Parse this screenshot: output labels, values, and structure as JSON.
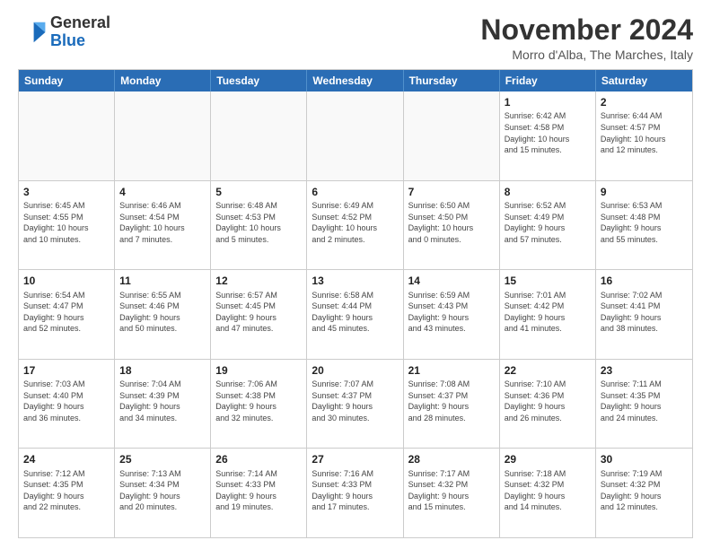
{
  "logo": {
    "text_general": "General",
    "text_blue": "Blue"
  },
  "title": "November 2024",
  "subtitle": "Morro d'Alba, The Marches, Italy",
  "header_days": [
    "Sunday",
    "Monday",
    "Tuesday",
    "Wednesday",
    "Thursday",
    "Friday",
    "Saturday"
  ],
  "weeks": [
    [
      {
        "day": "",
        "info": ""
      },
      {
        "day": "",
        "info": ""
      },
      {
        "day": "",
        "info": ""
      },
      {
        "day": "",
        "info": ""
      },
      {
        "day": "",
        "info": ""
      },
      {
        "day": "1",
        "info": "Sunrise: 6:42 AM\nSunset: 4:58 PM\nDaylight: 10 hours\nand 15 minutes."
      },
      {
        "day": "2",
        "info": "Sunrise: 6:44 AM\nSunset: 4:57 PM\nDaylight: 10 hours\nand 12 minutes."
      }
    ],
    [
      {
        "day": "3",
        "info": "Sunrise: 6:45 AM\nSunset: 4:55 PM\nDaylight: 10 hours\nand 10 minutes."
      },
      {
        "day": "4",
        "info": "Sunrise: 6:46 AM\nSunset: 4:54 PM\nDaylight: 10 hours\nand 7 minutes."
      },
      {
        "day": "5",
        "info": "Sunrise: 6:48 AM\nSunset: 4:53 PM\nDaylight: 10 hours\nand 5 minutes."
      },
      {
        "day": "6",
        "info": "Sunrise: 6:49 AM\nSunset: 4:52 PM\nDaylight: 10 hours\nand 2 minutes."
      },
      {
        "day": "7",
        "info": "Sunrise: 6:50 AM\nSunset: 4:50 PM\nDaylight: 10 hours\nand 0 minutes."
      },
      {
        "day": "8",
        "info": "Sunrise: 6:52 AM\nSunset: 4:49 PM\nDaylight: 9 hours\nand 57 minutes."
      },
      {
        "day": "9",
        "info": "Sunrise: 6:53 AM\nSunset: 4:48 PM\nDaylight: 9 hours\nand 55 minutes."
      }
    ],
    [
      {
        "day": "10",
        "info": "Sunrise: 6:54 AM\nSunset: 4:47 PM\nDaylight: 9 hours\nand 52 minutes."
      },
      {
        "day": "11",
        "info": "Sunrise: 6:55 AM\nSunset: 4:46 PM\nDaylight: 9 hours\nand 50 minutes."
      },
      {
        "day": "12",
        "info": "Sunrise: 6:57 AM\nSunset: 4:45 PM\nDaylight: 9 hours\nand 47 minutes."
      },
      {
        "day": "13",
        "info": "Sunrise: 6:58 AM\nSunset: 4:44 PM\nDaylight: 9 hours\nand 45 minutes."
      },
      {
        "day": "14",
        "info": "Sunrise: 6:59 AM\nSunset: 4:43 PM\nDaylight: 9 hours\nand 43 minutes."
      },
      {
        "day": "15",
        "info": "Sunrise: 7:01 AM\nSunset: 4:42 PM\nDaylight: 9 hours\nand 41 minutes."
      },
      {
        "day": "16",
        "info": "Sunrise: 7:02 AM\nSunset: 4:41 PM\nDaylight: 9 hours\nand 38 minutes."
      }
    ],
    [
      {
        "day": "17",
        "info": "Sunrise: 7:03 AM\nSunset: 4:40 PM\nDaylight: 9 hours\nand 36 minutes."
      },
      {
        "day": "18",
        "info": "Sunrise: 7:04 AM\nSunset: 4:39 PM\nDaylight: 9 hours\nand 34 minutes."
      },
      {
        "day": "19",
        "info": "Sunrise: 7:06 AM\nSunset: 4:38 PM\nDaylight: 9 hours\nand 32 minutes."
      },
      {
        "day": "20",
        "info": "Sunrise: 7:07 AM\nSunset: 4:37 PM\nDaylight: 9 hours\nand 30 minutes."
      },
      {
        "day": "21",
        "info": "Sunrise: 7:08 AM\nSunset: 4:37 PM\nDaylight: 9 hours\nand 28 minutes."
      },
      {
        "day": "22",
        "info": "Sunrise: 7:10 AM\nSunset: 4:36 PM\nDaylight: 9 hours\nand 26 minutes."
      },
      {
        "day": "23",
        "info": "Sunrise: 7:11 AM\nSunset: 4:35 PM\nDaylight: 9 hours\nand 24 minutes."
      }
    ],
    [
      {
        "day": "24",
        "info": "Sunrise: 7:12 AM\nSunset: 4:35 PM\nDaylight: 9 hours\nand 22 minutes."
      },
      {
        "day": "25",
        "info": "Sunrise: 7:13 AM\nSunset: 4:34 PM\nDaylight: 9 hours\nand 20 minutes."
      },
      {
        "day": "26",
        "info": "Sunrise: 7:14 AM\nSunset: 4:33 PM\nDaylight: 9 hours\nand 19 minutes."
      },
      {
        "day": "27",
        "info": "Sunrise: 7:16 AM\nSunset: 4:33 PM\nDaylight: 9 hours\nand 17 minutes."
      },
      {
        "day": "28",
        "info": "Sunrise: 7:17 AM\nSunset: 4:32 PM\nDaylight: 9 hours\nand 15 minutes."
      },
      {
        "day": "29",
        "info": "Sunrise: 7:18 AM\nSunset: 4:32 PM\nDaylight: 9 hours\nand 14 minutes."
      },
      {
        "day": "30",
        "info": "Sunrise: 7:19 AM\nSunset: 4:32 PM\nDaylight: 9 hours\nand 12 minutes."
      }
    ]
  ]
}
